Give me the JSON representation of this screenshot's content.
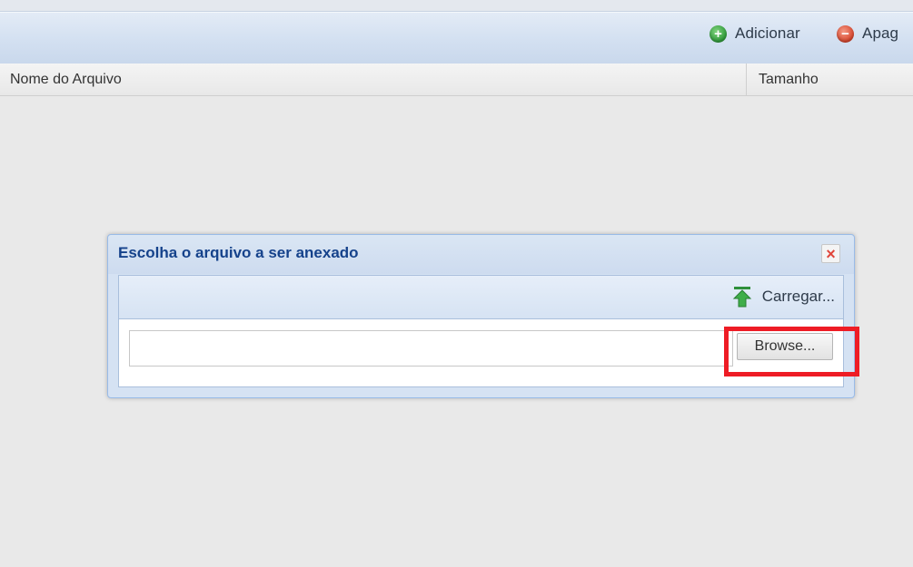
{
  "toolbar": {
    "add_label": "Adicionar",
    "delete_label": "Apag",
    "add_icon": "plus-circle-icon",
    "delete_icon": "minus-circle-icon",
    "add_color": "#2f9b3a",
    "delete_color": "#d8452c"
  },
  "grid": {
    "columns": [
      "Nome do Arquivo",
      "Tamanho"
    ],
    "rows": []
  },
  "dialog": {
    "title": "Escolha o arquivo a ser anexado",
    "close_icon": "close-icon",
    "upload_label": "Carregar...",
    "upload_icon": "upload-arrow-icon",
    "file_value": "",
    "browse_label": "Browse..."
  },
  "annotation": {
    "highlight_color": "#ee1c25",
    "highlight_target": "browse-button"
  },
  "colors": {
    "title_blue": "#15428b",
    "panel_blue": "#d5e2f3",
    "border_blue": "#99bbe8"
  }
}
